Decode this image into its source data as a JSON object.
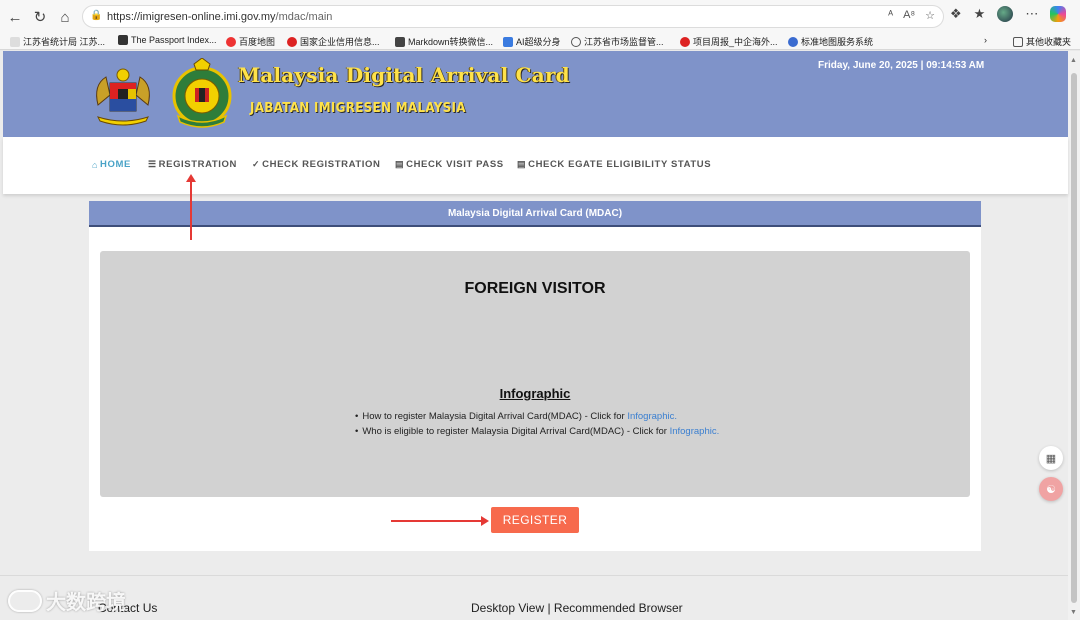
{
  "browser": {
    "url_host": "https://imigresen-online.imi.gov.my",
    "url_path": "/mdac/main",
    "bookmarks": [
      "江苏省统计局 江苏...",
      "The Passport Index...",
      "百度地图",
      "国家企业信用信息...",
      "Markdown转换微信...",
      "AI超级分身",
      "江苏省市场监督管...",
      "项目周报_中企海外...",
      "标准地图服务系统",
      "其他收藏夹"
    ]
  },
  "header": {
    "title": "Malaysia Digital Arrival Card",
    "subtitle": "JABATAN IMIGRESEN MALAYSIA",
    "datetime": "Friday, June 20, 2025 | 09:14:53 AM",
    "badge_text": "IMIGRESEN MALAYSIA"
  },
  "nav": {
    "items": [
      "HOME",
      "REGISTRATION",
      "CHECK REGISTRATION",
      "CHECK VISIT PASS",
      "CHECK EGATE ELIGIBILITY STATUS"
    ]
  },
  "card": {
    "heading": "Malaysia Digital Arrival Card (MDAC)",
    "panel_title": "FOREIGN VISITOR",
    "infographic_title": "Infographic",
    "info_items": [
      {
        "text": "How to register Malaysia Digital Arrival Card(MDAC) - Click for ",
        "link": "Infographic."
      },
      {
        "text": "Who is eligible to register Malaysia Digital Arrival Card(MDAC) - Click for ",
        "link": "Infographic."
      }
    ],
    "register_label": "REGISTER"
  },
  "footer": {
    "contact": "Contact Us",
    "center": "Desktop View | Recommended Browser"
  },
  "watermark": "大数跨境",
  "colors": {
    "banner": "#7f93c9",
    "title_yellow": "#ffe24a",
    "nav_active": "#4aa3c7",
    "register": "#f76a4d",
    "annotation_arrow": "#e53935",
    "link": "#3b7fd0"
  }
}
